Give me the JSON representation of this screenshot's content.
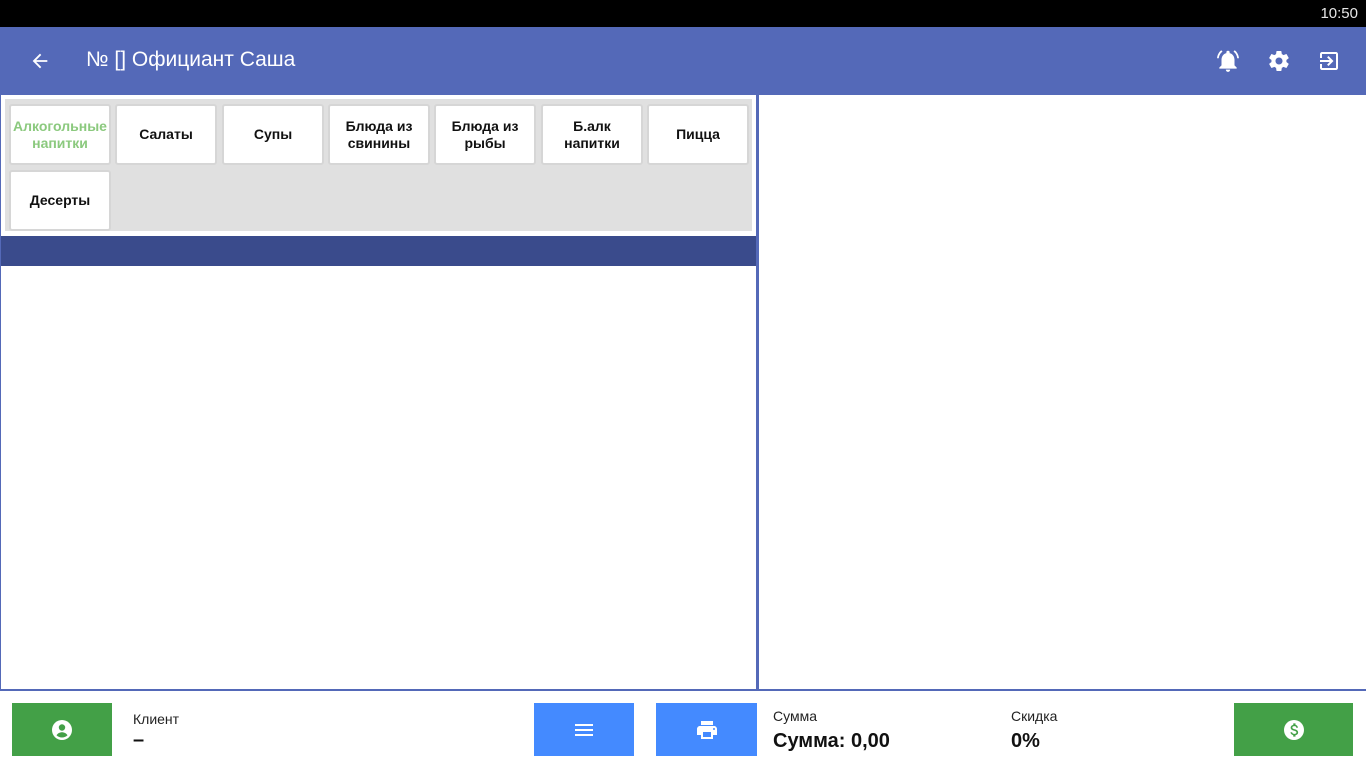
{
  "status_bar": {
    "time": "10:50"
  },
  "app_bar": {
    "title": "№ [] Официант Саша",
    "icons": [
      "arrow-back-icon",
      "bell-ring-icon",
      "gear-icon",
      "exit-icon"
    ],
    "color": "#5469b8"
  },
  "categories": [
    {
      "label": "Алкогольные напитки",
      "active": true
    },
    {
      "label": "Салаты",
      "active": false
    },
    {
      "label": "Супы",
      "active": false
    },
    {
      "label": "Блюда из свинины",
      "active": false
    },
    {
      "label": "Блюда из рыбы",
      "active": false
    },
    {
      "label": "Б.алк напитки",
      "active": false
    },
    {
      "label": "Пицца",
      "active": false
    },
    {
      "label": "Десерты",
      "active": false
    }
  ],
  "footer": {
    "client_label": "Клиент",
    "client_value": "–",
    "sum_label": "Сумма",
    "sum_value": "Сумма: 0,00",
    "discount_label": "Скидка",
    "discount_value": "0%",
    "icons": [
      "account-icon",
      "menu-icon",
      "printer-icon",
      "dollar-icon"
    ],
    "colors": {
      "green": "#43a047",
      "blue": "#448aff"
    }
  }
}
